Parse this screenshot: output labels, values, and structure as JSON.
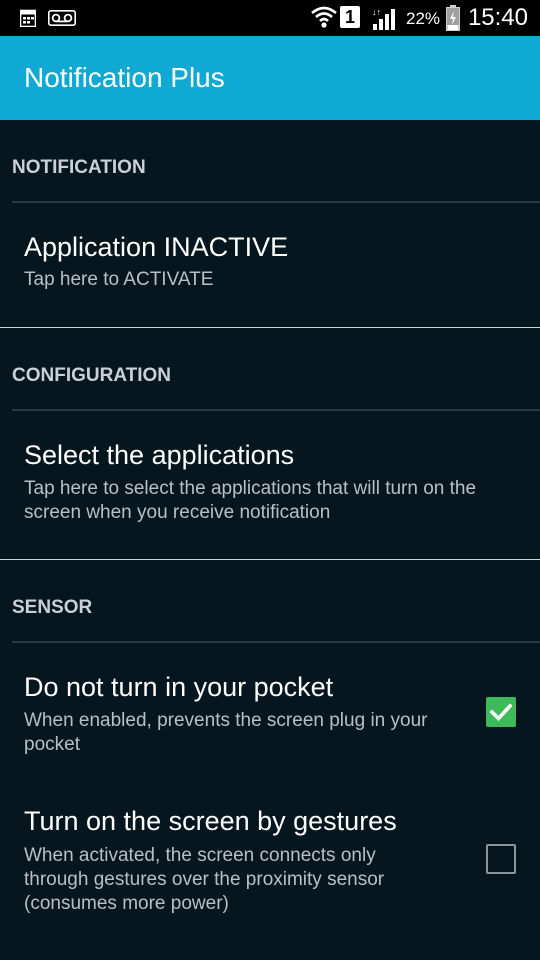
{
  "status_bar": {
    "left_icons": [
      "calendar-icon",
      "voicemail-icon"
    ],
    "sim_slot": "1",
    "battery_percent": "22%",
    "time": "15:40"
  },
  "app_bar": {
    "title": "Notification Plus"
  },
  "categories": {
    "notification": {
      "title": "NOTIFICATION",
      "items": [
        {
          "title": "Application INACTIVE",
          "summary": "Tap here to ACTIVATE"
        }
      ]
    },
    "configuration": {
      "title": "CONFIGURATION",
      "items": [
        {
          "title": "Select the applications",
          "summary": "Tap here to select the applications that will turn on the screen when you receive notification"
        }
      ]
    },
    "sensor": {
      "title": "SENSOR",
      "items": [
        {
          "title": "Do not turn in your pocket",
          "summary": "When enabled, prevents the screen plug in your pocket",
          "checked": true
        },
        {
          "title": "Turn on the screen by gestures",
          "summary": "When activated, the screen connects only through gestures over the proximity sensor (consumes more power)",
          "checked": false
        }
      ]
    }
  },
  "colors": {
    "app_bar": "#10a9d3",
    "background": "#06161e",
    "checkbox_checked": "#3dbb5b"
  }
}
